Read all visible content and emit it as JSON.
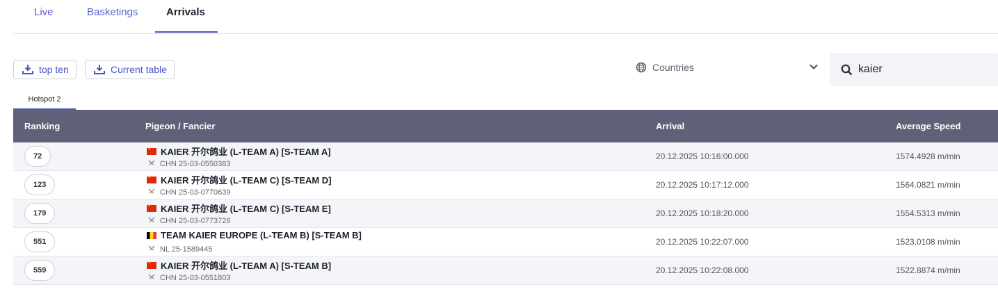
{
  "tabs": [
    {
      "label": "Live"
    },
    {
      "label": "Basketings"
    },
    {
      "label": "Arrivals"
    }
  ],
  "toolbar": {
    "top_ten_label": "top ten",
    "current_table_label": "Current table",
    "countries_label": "Countries",
    "search_value": "kaier"
  },
  "subtab": {
    "label": "Hotspot 2"
  },
  "table": {
    "headers": {
      "ranking": "Ranking",
      "pigeon": "Pigeon / Fancier",
      "arrival": "Arrival",
      "speed": "Average Speed"
    },
    "rows": [
      {
        "rank": "72",
        "flag": "cn",
        "name": "KAIER 开尔鸽业 (L-TEAM A) [S-TEAM A]",
        "ring": "CHN 25-03-0550383",
        "arrival": "20.12.2025 10:16:00.000",
        "speed": "1574.4928 m/min"
      },
      {
        "rank": "123",
        "flag": "cn",
        "name": "KAIER 开尔鸽业 (L-TEAM C) [S-TEAM D]",
        "ring": "CHN 25-03-0770639",
        "arrival": "20.12.2025 10:17:12.000",
        "speed": "1564.0821 m/min"
      },
      {
        "rank": "179",
        "flag": "cn",
        "name": "KAIER 开尔鸽业 (L-TEAM C) [S-TEAM E]",
        "ring": "CHN 25-03-0773726",
        "arrival": "20.12.2025 10:18:20.000",
        "speed": "1554.5313 m/min"
      },
      {
        "rank": "551",
        "flag": "be",
        "name": "TEAM KAIER EUROPE (L-TEAM B) [S-TEAM B]",
        "ring": "NL 25-1589445",
        "arrival": "20.12.2025 10:22:07.000",
        "speed": "1523.0108 m/min"
      },
      {
        "rank": "559",
        "flag": "cn",
        "name": "KAIER 开尔鸽业 (L-TEAM A) [S-TEAM B]",
        "ring": "CHN 25-03-0551803",
        "arrival": "20.12.2025 10:22:08.000",
        "speed": "1522.8874 m/min"
      }
    ]
  },
  "colors": {
    "accent": "#4f57c3",
    "header_bg": "#5e6177",
    "row_alt_bg": "#f4f5f9"
  },
  "icons": {
    "download": "download-icon",
    "globe": "globe-icon",
    "chevron": "chevron-down-icon",
    "search": "search-icon",
    "ring": "pigeon-ring-icon"
  }
}
